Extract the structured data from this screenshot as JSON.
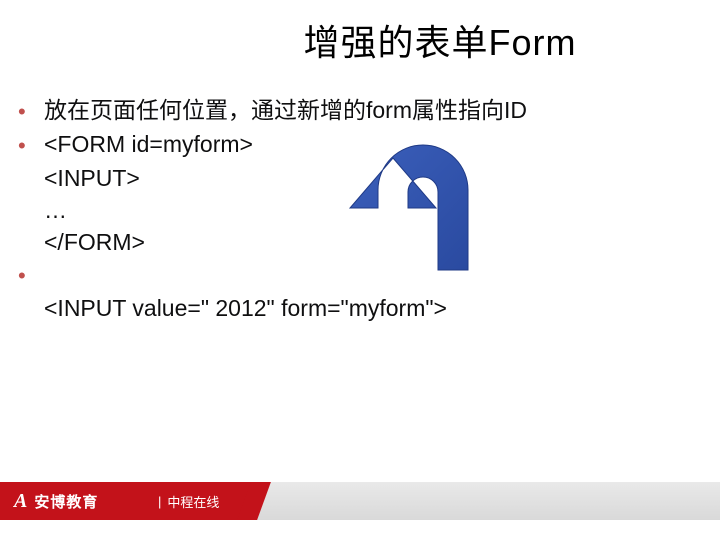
{
  "title": "增强的表单Form",
  "bullets": {
    "b1": "放在页面任何位置，通过新增的form属性指向ID",
    "b2_l1": "<FORM id=myform>",
    "b2_l2": "<INPUT>",
    "b2_l3": "…",
    "b2_l4": "</FORM>",
    "b3_l1": "<INPUT value=\" 2012\"  form=\"myform\">"
  },
  "footer": {
    "brand_mark": "A",
    "brand_text": "安博教育",
    "sub_text": "中程在线"
  }
}
